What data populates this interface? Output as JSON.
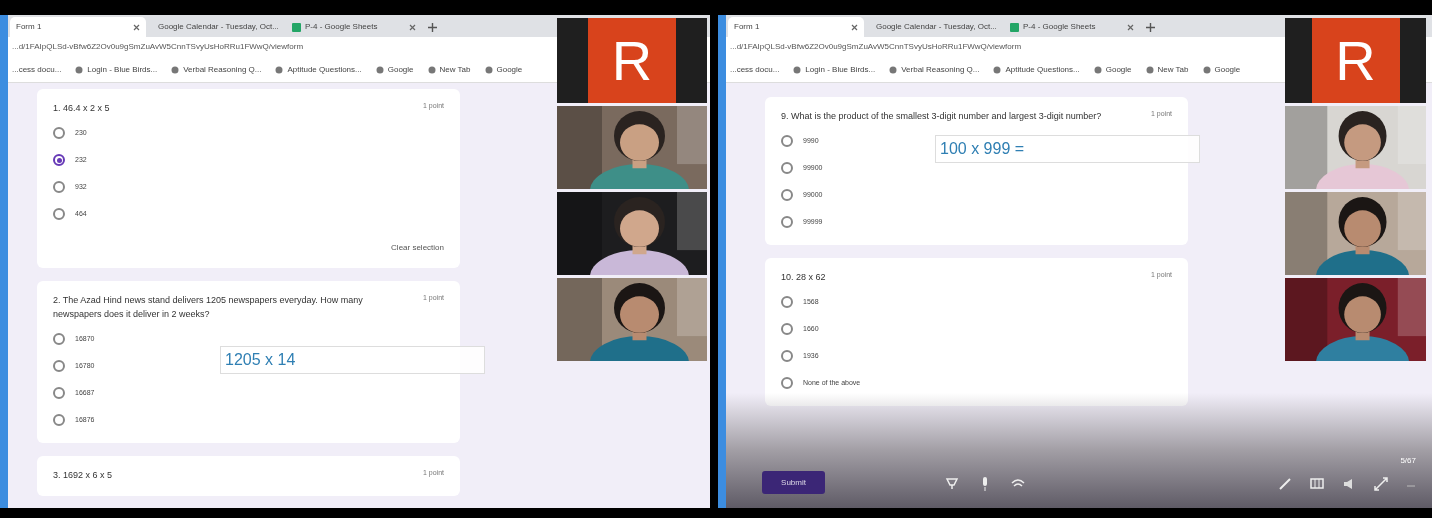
{
  "panels": [
    {
      "tabs": [
        {
          "title": "Form 1",
          "selected": true
        },
        {
          "title": "Google Calendar - Tuesday, Oct...",
          "selected": false
        },
        {
          "title": "P-4 - Google Sheets",
          "selected": false
        }
      ],
      "url": "...d/1FAIpQLSd-vBfw6Z2Ov0u9gSmZuAvW5CnnTSvyUsHoRRu1FWwQ/viewform",
      "bookmarks": [
        "...cess docu...",
        "Login - Blue Birds...",
        "Verbal Reasoning Q...",
        "Aptitude Questions...",
        "Google",
        "New Tab",
        "Google"
      ],
      "questions": [
        {
          "title": "1. 46.4 x 2 x 5",
          "points": "1 point",
          "options": [
            {
              "label": "230",
              "selected": false
            },
            {
              "label": "232",
              "selected": true
            },
            {
              "label": "932",
              "selected": false
            },
            {
              "label": "464",
              "selected": false
            }
          ],
          "clear": "Clear selection"
        },
        {
          "title": "2. The Azad Hind news stand delivers 1205 newspapers everyday. How many newspapers does it deliver in 2 weeks?",
          "points": "1 point",
          "options": [
            {
              "label": "16870",
              "selected": false
            },
            {
              "label": "16780",
              "selected": false
            },
            {
              "label": "16687",
              "selected": false
            },
            {
              "label": "16876",
              "selected": false
            }
          ]
        },
        {
          "title": "3. 1692 x 6 x 5",
          "points": "1 point"
        }
      ],
      "overlay_input": {
        "value": "1205 x 14"
      },
      "participants": [
        {
          "kind": "avatar",
          "initial": "R"
        },
        {
          "kind": "video"
        },
        {
          "kind": "video"
        },
        {
          "kind": "video"
        }
      ]
    },
    {
      "tabs": [
        {
          "title": "Form 1",
          "selected": true
        },
        {
          "title": "Google Calendar - Tuesday, Oct...",
          "selected": false
        },
        {
          "title": "P-4 - Google Sheets",
          "selected": false
        }
      ],
      "url": "...d/1FAIpQLSd-vBfw6Z2Ov0u9gSmZuAvW5CnnTSvyUsHoRRu1FWwQ/viewform",
      "bookmarks": [
        "...cess docu...",
        "Login - Blue Birds...",
        "Verbal Reasoning Q...",
        "Aptitude Questions...",
        "Google",
        "New Tab",
        "Google"
      ],
      "questions": [
        {
          "title": "9. What is the product of the smallest 3-digit number and largest 3-digit number?",
          "points": "1 point",
          "options": [
            {
              "label": "9990",
              "selected": false
            },
            {
              "label": "99900",
              "selected": false
            },
            {
              "label": "99000",
              "selected": false
            },
            {
              "label": "99999",
              "selected": false
            }
          ]
        },
        {
          "title": "10. 28 x 62",
          "points": "1 point",
          "options": [
            {
              "label": "1568",
              "selected": false
            },
            {
              "label": "1660",
              "selected": false
            },
            {
              "label": "1936",
              "selected": false
            },
            {
              "label": "None of the above",
              "selected": false
            }
          ]
        }
      ],
      "overlay_input": {
        "value": "100 x 999 = "
      },
      "participants": [
        {
          "kind": "avatar",
          "initial": "R"
        },
        {
          "kind": "video"
        },
        {
          "kind": "video"
        },
        {
          "kind": "video"
        }
      ],
      "bottom_bar": {
        "submit": "Submit",
        "page": "5/67"
      }
    }
  ]
}
